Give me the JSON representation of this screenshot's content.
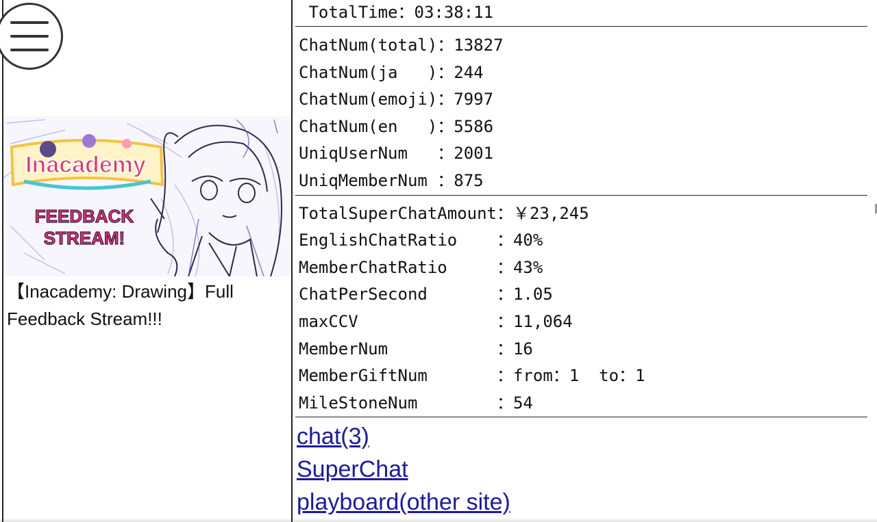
{
  "menu": {
    "icon": "hamburger-menu-icon"
  },
  "video": {
    "thumbnail_logo": "Inacademy",
    "thumbnail_line1": "FEEDBACK",
    "thumbnail_line2": "STREAM!",
    "title": "【Inacademy: Drawing】Full Feedback Stream!!!"
  },
  "stats": {
    "total_time": " TotalTime：03:38:11",
    "chat": [
      "ChatNum(total)：13827",
      "ChatNum(ja   )：244",
      "ChatNum(emoji)：7997",
      "ChatNum(en   )：5586",
      "UniqUserNum   ：2001",
      "UniqMemberNum ：875"
    ],
    "details": [
      "TotalSuperChatAmount：￥23,245",
      "EnglishChatRatio    ：40%",
      "MemberChatRatio     ：43%",
      "ChatPerSecond       ：1.05",
      "maxCCV              ：11,064",
      "MemberNum           ：16",
      "MemberGiftNum       ：from：1  to：1",
      "MileStoneNum        ：54"
    ]
  },
  "links": {
    "chat": "chat(3)",
    "superchat": "SuperChat",
    "playboard": "playboard(other site)"
  },
  "colors": {
    "link": "#1a1aa6",
    "logo_pink": "#e8336e",
    "logo_yellow": "#f5c242",
    "sketch": "#6a6ad8"
  }
}
